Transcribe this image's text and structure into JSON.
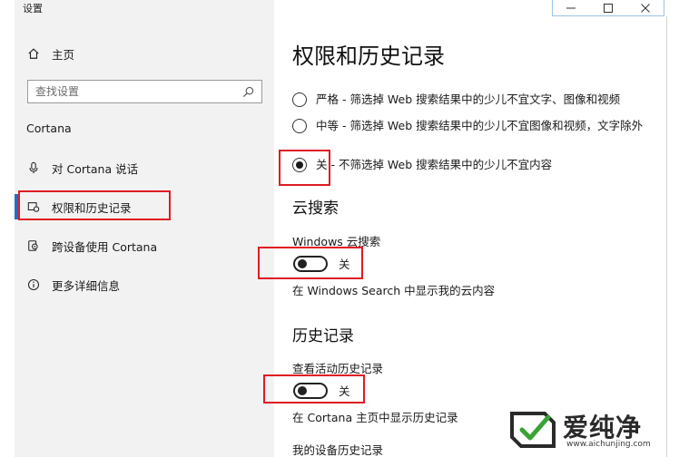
{
  "window": {
    "app_title": "设置",
    "controls": {
      "minimize_icon": "minimize-icon",
      "maximize_icon": "maximize-icon",
      "close_icon": "close-icon"
    }
  },
  "sidebar": {
    "home": {
      "label": "主页",
      "icon": "home-icon"
    },
    "search": {
      "placeholder": "查找设置",
      "icon": "search-icon"
    },
    "section_label": "Cortana",
    "items": [
      {
        "label": "对 Cortana 说话",
        "icon": "microphone-icon",
        "active": false
      },
      {
        "label": "权限和历史记录",
        "icon": "permissions-icon",
        "active": true
      },
      {
        "label": "跨设备使用 Cortana",
        "icon": "devices-icon",
        "active": false
      },
      {
        "label": "更多详细信息",
        "icon": "info-icon",
        "active": false
      }
    ]
  },
  "main": {
    "title": "权限和历史记录",
    "safesearch_options": [
      {
        "label": "严格 - 筛选掉 Web 搜索结果中的少儿不宜文字、图像和视频",
        "checked": false
      },
      {
        "label": "中等 - 筛选掉 Web 搜索结果中的少儿不宜图像和视频，文字除外",
        "checked": false
      },
      {
        "label": "关 - 不筛选掉 Web 搜索结果中的少儿不宜内容",
        "checked": true
      }
    ],
    "cloud_search": {
      "heading": "云搜索",
      "setting_label": "Windows 云搜索",
      "toggle_state": "关",
      "description": "在 Windows Search 中显示我的云内容"
    },
    "history": {
      "heading": "历史记录",
      "setting_label": "查看活动历史记录",
      "toggle_state": "关",
      "description": "在 Cortana 主页中显示历史记录",
      "device_history_label": "我的设备历史记录"
    }
  },
  "watermark": {
    "brand_text": "爱纯净",
    "url": "www.aichunjing.com"
  },
  "colors": {
    "sidebar_bg": "#f2f2f2",
    "accent": "#1f6fc5",
    "highlight_box": "#e01b24",
    "text": "#1a1a1a"
  }
}
